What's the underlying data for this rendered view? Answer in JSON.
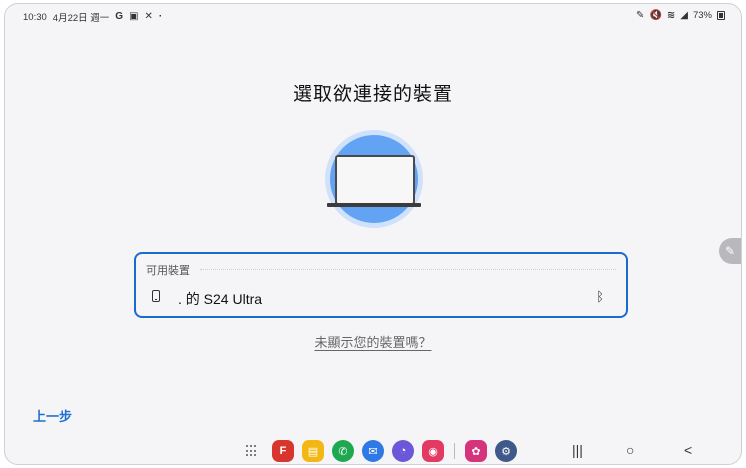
{
  "status_bar": {
    "time": "10:30",
    "date": "4月22日 週一",
    "left_icons": [
      "g-icon",
      "gallery-icon",
      "tools-icon",
      "dot-icon"
    ],
    "right_icons": [
      "pen-icon",
      "mute-icon",
      "wifi-icon",
      "signal-icon"
    ],
    "battery": "73%"
  },
  "title": "選取欲連接的裝置",
  "device_list": {
    "header": "可用裝置",
    "devices": [
      {
        "name": ". 的 S24 Ultra",
        "icon": "phone-icon",
        "trailing_icon": "bluetooth-icon"
      }
    ]
  },
  "not_shown_link": "未顯示您的裝置嗎？",
  "back_button": "上一步",
  "taskbar": {
    "apps": [
      {
        "name": "flipboard-app",
        "color": "#d9352f",
        "glyph": "F"
      },
      {
        "name": "notes-app",
        "color": "#f3b713",
        "glyph": "▤"
      },
      {
        "name": "phone-app",
        "color": "#1fa84f",
        "glyph": "✆"
      },
      {
        "name": "messages-app",
        "color": "#2f79e6",
        "glyph": "✉"
      },
      {
        "name": "internet-app",
        "color": "#6b57d9",
        "glyph": "◔"
      },
      {
        "name": "camera-app",
        "color": "#e33a64",
        "glyph": "◉"
      },
      {
        "name": "flower-app",
        "color": "#d6337d",
        "glyph": "✿"
      },
      {
        "name": "settings-app",
        "color": "#3f5a8a",
        "glyph": "⚙"
      }
    ],
    "nav": {
      "recents": "|||",
      "home": "○",
      "back": "<"
    }
  },
  "colors": {
    "accent": "#1a6bd0",
    "link_blue": "#1f6fd1",
    "illustration_blue": "#62a3f3"
  }
}
